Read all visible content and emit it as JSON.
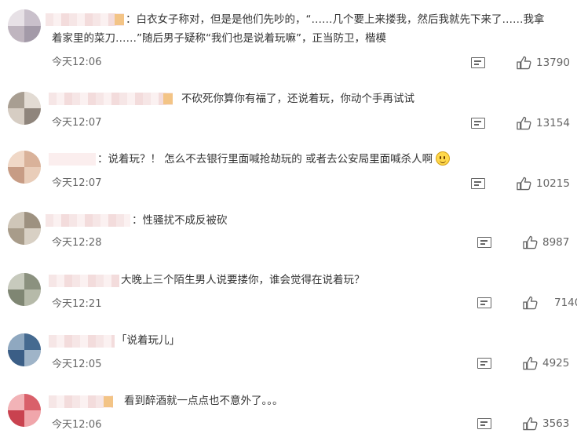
{
  "comments": [
    {
      "text_lines": [
        "：白衣女子称对，但是是他们先吵的，“……几个要上来搂我，然后我就先下来了……我拿",
        "着家里的菜刀……”随后男子疑称“我们也是说着玩嘛”，正当防卫，楷模"
      ],
      "time": "今天12:06",
      "likes": "13790"
    },
    {
      "text_lines": [
        "不砍死你算你有福了，还说着玩，你动个手再试试"
      ],
      "time": "今天12:07",
      "likes": "13154"
    },
    {
      "text_lines": [
        "：说着玩？！ 怎么不去银行里面喊抢劫玩的 或者去公安局里面喊杀人啊"
      ],
      "time": "今天12:07",
      "likes": "10215",
      "emoji": "smile-emoji"
    },
    {
      "text_lines": [
        "：性骚扰不成反被砍"
      ],
      "time": "今天12:28",
      "likes": "8987"
    },
    {
      "text_lines": [
        "大晚上三个陌生男人说要搂你，谁会觉得在说着玩？"
      ],
      "time": "今天12:21",
      "likes": "7140"
    },
    {
      "text_lines": [
        "「说着玩儿」"
      ],
      "time": "今天12:05",
      "likes": "4925"
    },
    {
      "text_lines": [
        "看到醉酒就一点点也不意外了。。。"
      ],
      "time": "今天12:06",
      "likes": "3563"
    }
  ],
  "icons": {
    "comment": "comment-icon",
    "like": "thumbs-up-icon"
  },
  "colors": {
    "text": "#333333",
    "meta": "#666666"
  }
}
